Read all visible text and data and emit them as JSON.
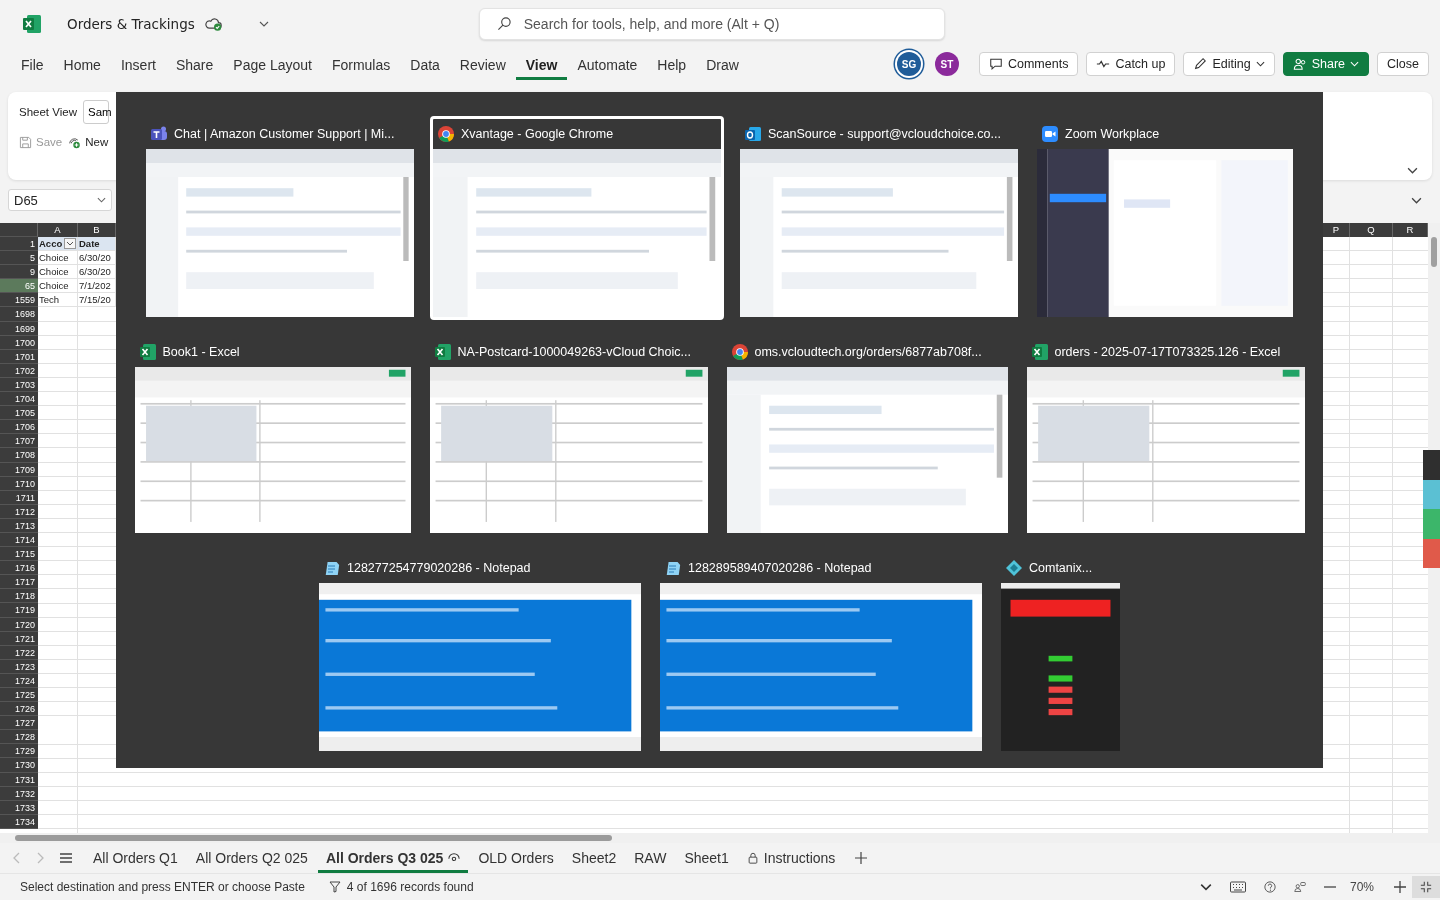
{
  "app": {
    "title": "Orders & Trackings",
    "search": {
      "placeholder": "Search for tools, help, and more (Alt + Q)"
    }
  },
  "menu": [
    {
      "label": "File",
      "selected": false
    },
    {
      "label": "Home",
      "selected": false
    },
    {
      "label": "Insert",
      "selected": false
    },
    {
      "label": "Share",
      "selected": false
    },
    {
      "label": "Page Layout",
      "selected": false
    },
    {
      "label": "Formulas",
      "selected": false
    },
    {
      "label": "Data",
      "selected": false
    },
    {
      "label": "Review",
      "selected": false
    },
    {
      "label": "View",
      "selected": true
    },
    {
      "label": "Automate",
      "selected": false
    },
    {
      "label": "Help",
      "selected": false
    },
    {
      "label": "Draw",
      "selected": false
    }
  ],
  "collaborators": [
    {
      "initials": "SG",
      "color": "#1f5c99"
    },
    {
      "initials": "ST",
      "color": "#8b2a9b"
    }
  ],
  "actions": [
    {
      "label": "Comments",
      "kind": "comments"
    },
    {
      "label": "Catch up",
      "kind": "catchup"
    },
    {
      "label": "Editing",
      "kind": "mode"
    },
    {
      "label": "Share",
      "kind": "share"
    },
    {
      "label": "Close",
      "kind": "plain"
    }
  ],
  "ribbon": {
    "group_label": "Sheet View",
    "dropdown": "Sam",
    "save": "Save",
    "new": "New"
  },
  "name_box": "D65",
  "grid": {
    "columns_left": [
      "A",
      "B"
    ],
    "columns_right": [
      "P",
      "Q",
      "R"
    ],
    "rows": [
      {
        "number": "1",
        "kind": "header",
        "selected": false,
        "cells": [
          "Acco",
          "Date"
        ]
      },
      {
        "number": "5",
        "kind": "data",
        "selected": false,
        "cells": [
          "Choice",
          "6/30/20"
        ]
      },
      {
        "number": "9",
        "kind": "data",
        "selected": false,
        "cells": [
          "Choice",
          "6/30/20"
        ]
      },
      {
        "number": "65",
        "kind": "data",
        "selected": true,
        "cells": [
          "Choice",
          "7/1/202"
        ]
      },
      {
        "number": "1559",
        "kind": "data",
        "selected": false,
        "cells": [
          "Tech",
          "7/15/20"
        ]
      }
    ],
    "empty_rows": [
      "1698",
      "1699",
      "1700",
      "1701",
      "1702",
      "1703",
      "1704",
      "1705",
      "1706",
      "1707",
      "1708",
      "1709",
      "1710",
      "1711",
      "1712",
      "1713",
      "1714",
      "1715",
      "1716",
      "1717",
      "1718",
      "1719",
      "1720",
      "1721",
      "1722",
      "1723",
      "1724",
      "1725",
      "1726",
      "1727",
      "1728",
      "1729",
      "1730",
      "1731",
      "1732",
      "1733",
      "1734"
    ]
  },
  "switcher": {
    "rows": [
      {
        "windows": [
          {
            "title": "Chat | Amazon Customer Support | Mi...",
            "kind": "teams",
            "selected": false
          },
          {
            "title": "Xvantage - Google Chrome",
            "kind": "chrome",
            "selected": true
          },
          {
            "title": "ScanSource - support@vcloudchoice.co...",
            "kind": "outlook",
            "selected": false
          },
          {
            "title": "Zoom Workplace",
            "kind": "zoom",
            "selected": false
          }
        ]
      },
      {
        "windows": [
          {
            "title": "Book1 - Excel",
            "kind": "excel",
            "selected": false
          },
          {
            "title": "NA-Postcard-1000049263-vCloud Choic...",
            "kind": "excel",
            "selected": false
          },
          {
            "title": "oms.vcloudtech.org/orders/6877ab708f...",
            "kind": "chrome",
            "selected": false
          },
          {
            "title": "orders - 2025-07-17T073325.126 - Excel",
            "kind": "excel",
            "selected": false
          }
        ]
      },
      {
        "windows": [
          {
            "title": "128277254779020286 - Notepad",
            "kind": "notepad",
            "selected": false
          },
          {
            "title": "128289589407020286 - Notepad",
            "kind": "notepad",
            "selected": false
          },
          {
            "title": "Comtanix...",
            "kind": "comtanix",
            "selected": false
          }
        ]
      }
    ]
  },
  "sheets": [
    {
      "label": "All Orders Q1",
      "kind": "plain",
      "selected": false
    },
    {
      "label": "All Orders Q2 025",
      "kind": "plain",
      "selected": false
    },
    {
      "label": "All Orders Q3 025",
      "kind": "viewed",
      "selected": true
    },
    {
      "label": "OLD Orders",
      "kind": "plain",
      "selected": false
    },
    {
      "label": "Sheet2",
      "kind": "plain",
      "selected": false
    },
    {
      "label": "RAW",
      "kind": "plain",
      "selected": false
    },
    {
      "label": "Sheet1",
      "kind": "plain",
      "selected": false
    },
    {
      "label": "Instructions",
      "kind": "locked",
      "selected": false
    }
  ],
  "status": {
    "message": "Select destination and press ENTER or choose Paste",
    "filter": "4 of 1696 records found",
    "zoom": "70%"
  }
}
